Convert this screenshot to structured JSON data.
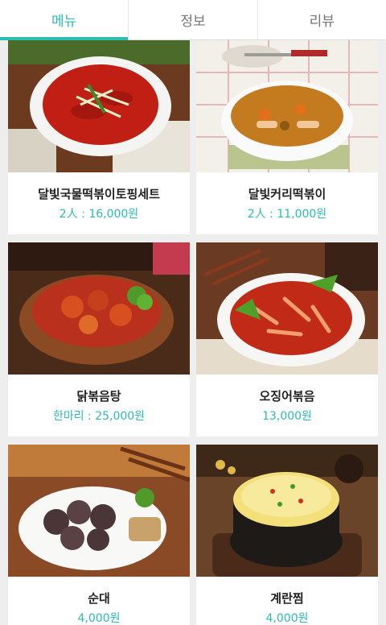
{
  "tabs": [
    {
      "label": "메뉴",
      "active": true
    },
    {
      "label": "정보",
      "active": false
    },
    {
      "label": "리뷰",
      "active": false
    }
  ],
  "accent_color": "#2bbcb3",
  "menu": [
    {
      "name": "달빛국물떡볶이토핑세트",
      "price": "2人 : 16,000원",
      "image": "tteokbokki-soup-photo"
    },
    {
      "name": "달빛커리떡볶이",
      "price": "2人 : 11,000원",
      "image": "curry-tteokbokki-photo"
    },
    {
      "name": "닭볶음탕",
      "price": "한마리 : 25,000원",
      "image": "braised-chicken-photo"
    },
    {
      "name": "오징어볶음",
      "price": "13,000원",
      "image": "stir-fried-squid-photo"
    },
    {
      "name": "순대",
      "price": "4,000원",
      "image": "sundae-photo"
    },
    {
      "name": "계란찜",
      "price": "4,000원",
      "image": "steamed-egg-photo"
    }
  ]
}
